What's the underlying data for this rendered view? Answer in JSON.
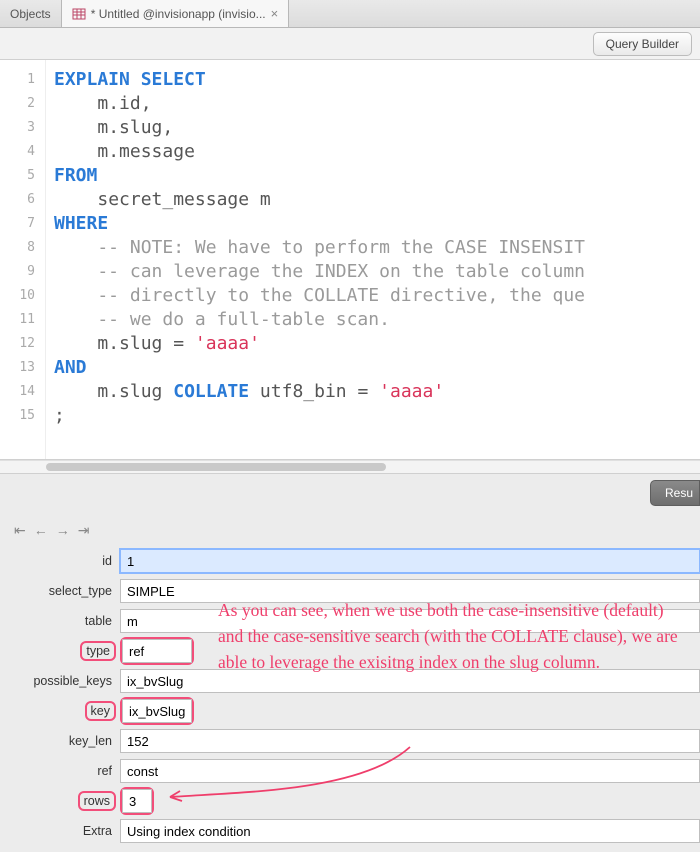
{
  "tabs": {
    "objects": "Objects",
    "active_label": "* Untitled @invisionapp (invisio...",
    "close_glyph": "×"
  },
  "toolbar": {
    "query_builder": "Query Builder",
    "results": "Resu"
  },
  "code": {
    "lines": [
      "1",
      "2",
      "3",
      "4",
      "5",
      "6",
      "7",
      "8",
      "9",
      "10",
      "11",
      "12",
      "13",
      "14",
      "15"
    ],
    "l1a": "EXPLAIN",
    "l1b": "SELECT",
    "l2a": "m",
    "l2b": ".",
    "l2c": "id",
    "l2d": ",",
    "l3a": "m",
    "l3b": ".",
    "l3c": "slug",
    "l3d": ",",
    "l4a": "m",
    "l4b": ".",
    "l4c": "message",
    "l5": "FROM",
    "l6": "secret_message m",
    "l7": "WHERE",
    "l8": "    -- NOTE: We have to perform the CASE INSENSIT",
    "l9": "    -- can leverage the INDEX on the table column",
    "l10": "    -- directly to the COLLATE directive, the que",
    "l11": "    -- we do a full-table scan.",
    "l12a": "m",
    "l12b": ".",
    "l12c": "slug",
    "l12d": " = ",
    "l12e": "'aaaa'",
    "l13": "AND",
    "l14a": "m",
    "l14b": ".",
    "l14c": "slug ",
    "l14d": "COLLATE",
    "l14e": " utf8_bin ",
    "l14f": "= ",
    "l14g": "'aaaa'",
    "l15": ";"
  },
  "nav": {
    "first": "⇤",
    "prev": "←",
    "next": "→",
    "last": "⇥"
  },
  "fields": {
    "id": {
      "label": "id",
      "value": "1"
    },
    "select_type": {
      "label": "select_type",
      "value": "SIMPLE"
    },
    "table": {
      "label": "table",
      "value": "m"
    },
    "type": {
      "label": "type",
      "value": "ref"
    },
    "possible_keys": {
      "label": "possible_keys",
      "value": "ix_bvSlug"
    },
    "key": {
      "label": "key",
      "value": "ix_bvSlug"
    },
    "key_len": {
      "label": "key_len",
      "value": "152"
    },
    "ref": {
      "label": "ref",
      "value": "const"
    },
    "rows": {
      "label": "rows",
      "value": "3"
    },
    "extra": {
      "label": "Extra",
      "value": "Using index condition"
    }
  },
  "annotation": "As you can see, when we use both the case-insensitive (default) and the case-sensitive search (with the COLLATE clause), we are able to leverage the exisitng index on the slug column."
}
